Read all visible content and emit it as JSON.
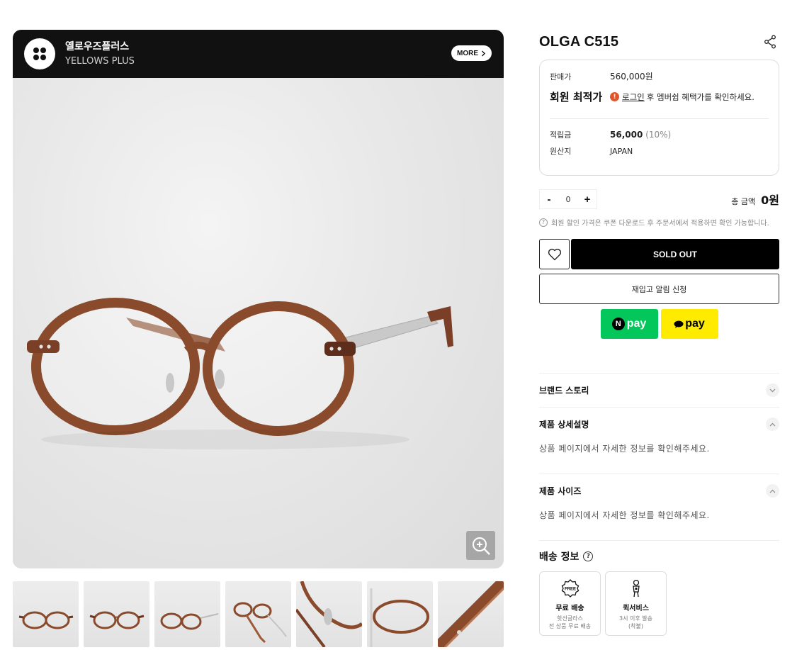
{
  "brand": {
    "name_kr": "옐로우즈플러스",
    "name_en": "YELLOWS PLUS",
    "more_label": "MORE"
  },
  "product": {
    "title": "OLGA C515",
    "price_label": "판매가",
    "price": "560,000원",
    "member_label": "회원 최적가",
    "member_login": "로그인",
    "member_msg": "후 멤버쉽 혜택가를 확인하세요.",
    "points_label": "적립금",
    "points_value": "56,000",
    "points_rate": "(10%)",
    "origin_label": "원산지",
    "origin_value": "JAPAN"
  },
  "order": {
    "minus": "-",
    "quantity": "0",
    "plus": "+",
    "total_label": "총 금액",
    "total_value": "0원",
    "notice": "회원 할인 가격은 쿠폰 다운로드 후 주문서에서 적용하면 확인 가능합니다.",
    "soldout_label": "SOLD OUT",
    "restock_label": "재입고 알림 신청",
    "npay_label": "pay",
    "kpay_label": "pay"
  },
  "accordion": [
    {
      "title": "브랜드 스토리",
      "body": ""
    },
    {
      "title": "제품 상세설명",
      "body": "상품 페이지에서 자세한 정보를 확인해주세요."
    },
    {
      "title": "제품 사이즈",
      "body": "상품 페이지에서 자세한 정보를 확인해주세요."
    }
  ],
  "shipping": {
    "title": "배송 정보",
    "cards": [
      {
        "icon": "free-tag-icon",
        "badge": "FREE",
        "name": "무료 배송",
        "desc_1": "핫선글라스",
        "desc_2": "전 상품 무료 배송"
      },
      {
        "icon": "courier-icon",
        "name": "퀵서비스",
        "desc_1": "3시 이후 발송",
        "desc_2": "(착불)"
      }
    ]
  },
  "colors": {
    "frame_brown": "#8a4a2c",
    "npay_green": "#03c75a",
    "kpay_yellow": "#ffeb00",
    "alert_orange": "#e2552b"
  }
}
